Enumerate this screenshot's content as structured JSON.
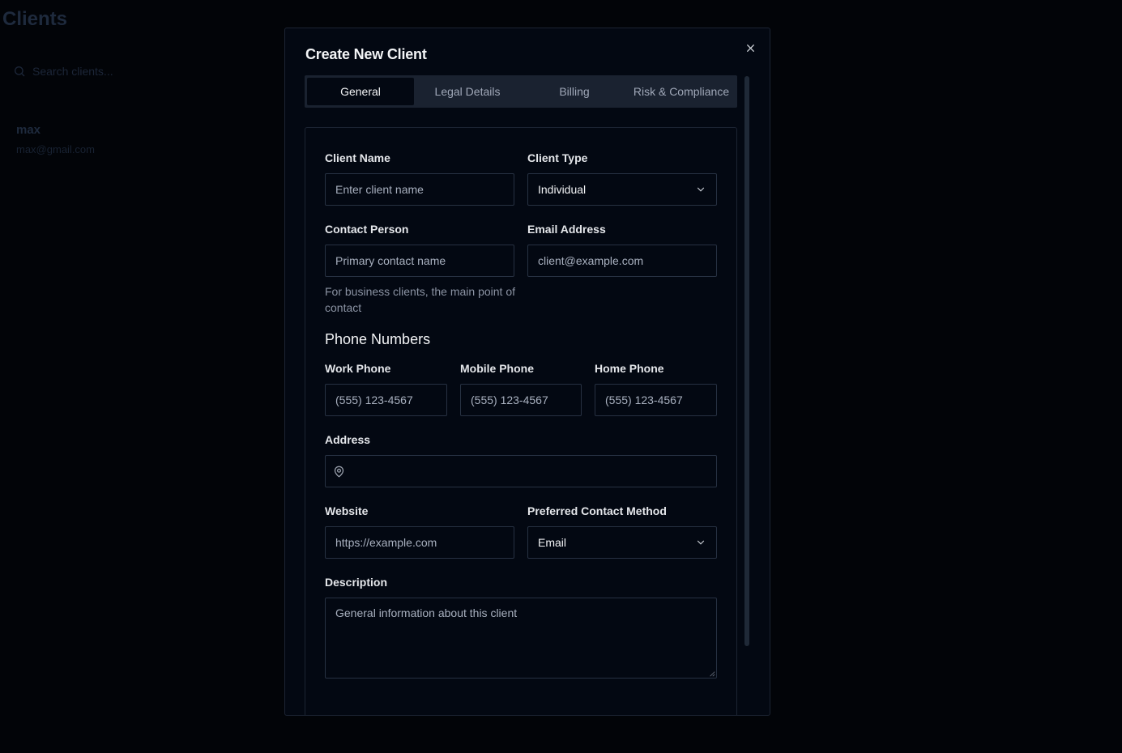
{
  "background": {
    "title": "Clients",
    "search_placeholder": "Search clients...",
    "client": {
      "name": "max",
      "email": "max@gmail.com"
    }
  },
  "modal": {
    "title": "Create New Client",
    "tabs": [
      "General",
      "Legal Details",
      "Billing",
      "Risk & Compliance"
    ],
    "active_tab": "General",
    "fields": {
      "client_name": {
        "label": "Client Name",
        "placeholder": "Enter client name"
      },
      "client_type": {
        "label": "Client Type",
        "value": "Individual"
      },
      "contact_person": {
        "label": "Contact Person",
        "placeholder": "Primary contact name",
        "helper": "For business clients, the main point of contact"
      },
      "email": {
        "label": "Email Address",
        "placeholder": "client@example.com"
      },
      "phone_section": "Phone Numbers",
      "work_phone": {
        "label": "Work Phone",
        "placeholder": "(555) 123-4567"
      },
      "mobile_phone": {
        "label": "Mobile Phone",
        "placeholder": "(555) 123-4567"
      },
      "home_phone": {
        "label": "Home Phone",
        "placeholder": "(555) 123-4567"
      },
      "address": {
        "label": "Address",
        "value": ""
      },
      "website": {
        "label": "Website",
        "placeholder": "https://example.com"
      },
      "preferred_contact": {
        "label": "Preferred Contact Method",
        "value": "Email"
      },
      "description": {
        "label": "Description",
        "placeholder": "General information about this client"
      }
    }
  },
  "icons": {
    "search": "search-icon",
    "close": "close-icon",
    "chevron": "chevron-down-icon",
    "map_pin": "map-pin-icon"
  },
  "colors": {
    "backdrop": "#020408",
    "modal_bg": "#030812",
    "border": "#273142",
    "tab_bar": "#1a2230"
  }
}
